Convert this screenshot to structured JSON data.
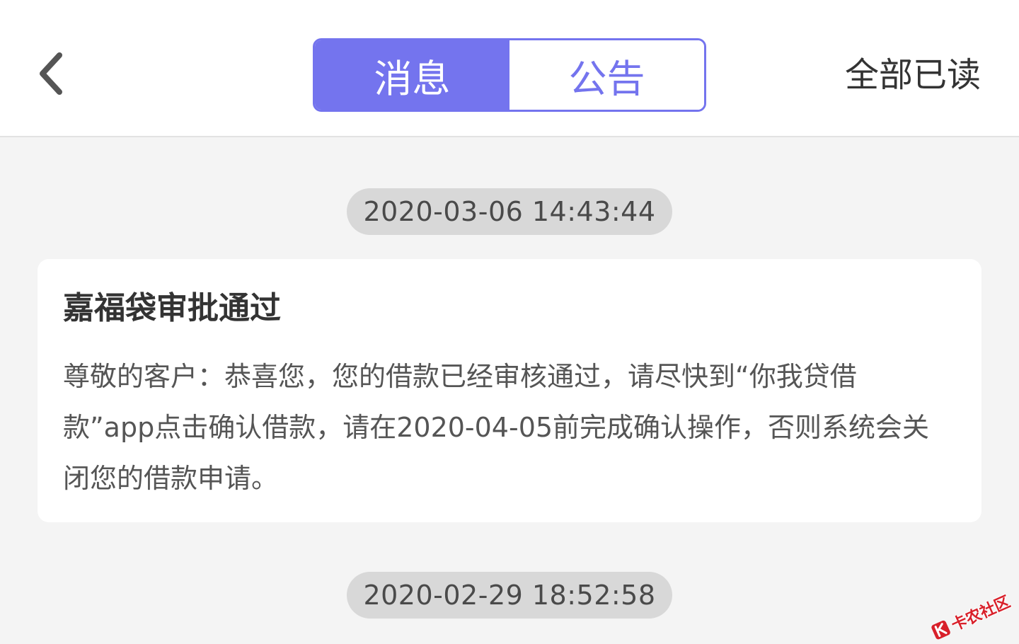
{
  "header": {
    "tabs": [
      {
        "label": "消息",
        "active": true
      },
      {
        "label": "公告",
        "active": false
      }
    ],
    "mark_all_read_label": "全部已读",
    "back_icon": "chevron-left-icon"
  },
  "messages": [
    {
      "time": "2020-03-06 14:43:44",
      "title": "嘉福袋审批通过",
      "body": "尊敬的客户：恭喜您，您的借款已经审核通过，请尽快到“你我贷借款”app点击确认借款，请在2020-04-05前完成确认操作，否则系统会关闭您的借款申请。"
    },
    {
      "time": "2020-02-29 18:52:58"
    }
  ],
  "watermark": {
    "text": "卡农社区"
  },
  "colors": {
    "accent": "#7474ee",
    "background": "#f4f4f4",
    "time_pill": "#d8d8d8",
    "watermark": "#d8202a"
  }
}
